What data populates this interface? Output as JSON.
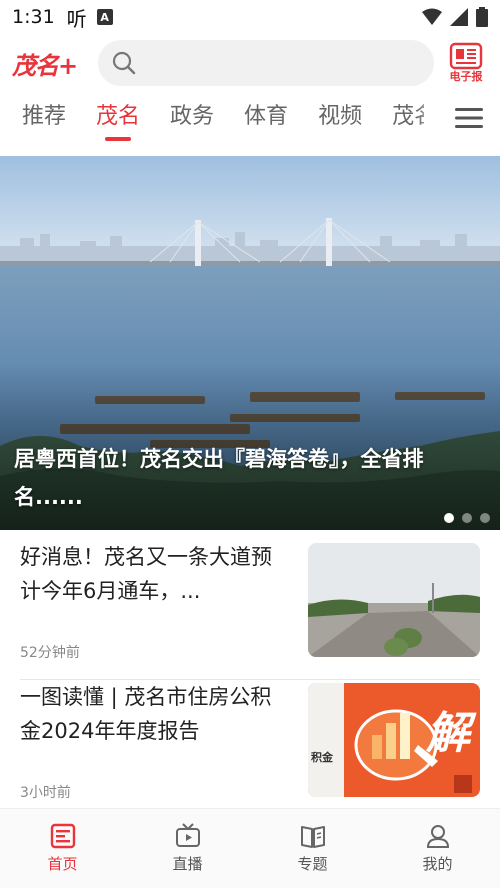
{
  "status_bar": {
    "time": "1:31",
    "hear_glyph": "听",
    "a_glyph": "A"
  },
  "header": {
    "logo": "茂名+",
    "search_placeholder": "",
    "epaper_label": "电子报"
  },
  "tabs": [
    {
      "label": "推荐",
      "active": false
    },
    {
      "label": "茂名",
      "active": true
    },
    {
      "label": "政务",
      "active": false
    },
    {
      "label": "体育",
      "active": false
    },
    {
      "label": "视频",
      "active": false
    },
    {
      "label": "茂名",
      "active": false
    }
  ],
  "hero": {
    "caption": "居粤西首位！茂名交出『碧海答卷』，全省排名......",
    "slides_total": 3,
    "slide_active": 1
  },
  "news": [
    {
      "title": "好消息！茂名又一条大道预计今年6月通车，...",
      "time": "52分钟前",
      "thumb": "road-photo"
    },
    {
      "title": "一图读懂 | 茂名市住房公积金2024年年度报告",
      "time": "3小时前",
      "thumb": "report-graphic",
      "thumb_text": "解",
      "thumb_small_text": "积金"
    }
  ],
  "bottom_nav": [
    {
      "label": "首页",
      "icon": "home-icon",
      "active": true
    },
    {
      "label": "直播",
      "icon": "tv-icon",
      "active": false
    },
    {
      "label": "专题",
      "icon": "book-icon",
      "active": false
    },
    {
      "label": "我的",
      "icon": "user-icon",
      "active": false
    }
  ],
  "colors": {
    "accent": "#e8343b",
    "text": "#222222",
    "muted": "#888888"
  }
}
